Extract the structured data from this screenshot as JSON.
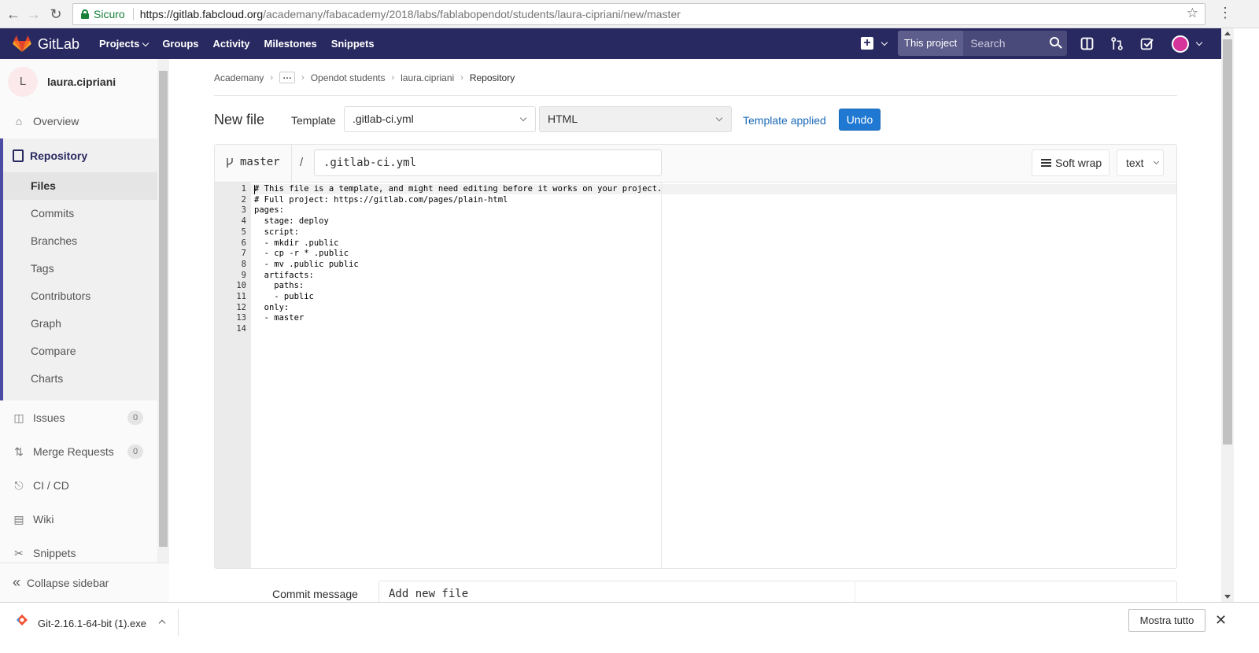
{
  "browser": {
    "secure_label": "Sicuro",
    "url_host": "https://gitlab.fabcloud.org",
    "url_path": "/academany/fabacademy/2018/labs/fablabopendot/students/laura-cipriani/new/master"
  },
  "header": {
    "brand": "GitLab",
    "nav": [
      "Projects",
      "Groups",
      "Activity",
      "Milestones",
      "Snippets"
    ],
    "search_scope": "This project",
    "search_placeholder": "Search"
  },
  "sidebar": {
    "avatar_letter": "L",
    "username": "laura.cipriani",
    "overview": "Overview",
    "repository": "Repository",
    "repo_items": [
      "Files",
      "Commits",
      "Branches",
      "Tags",
      "Contributors",
      "Graph",
      "Compare",
      "Charts"
    ],
    "issues": "Issues",
    "issues_count": "0",
    "merge_requests": "Merge Requests",
    "mr_count": "0",
    "cicd": "CI / CD",
    "wiki": "Wiki",
    "snippets": "Snippets",
    "collapse": "Collapse sidebar"
  },
  "breadcrumb": {
    "items": [
      "Academany",
      "Opendot students",
      "laura.cipriani"
    ],
    "current": "Repository"
  },
  "editor": {
    "title": "New file",
    "template_label": "Template",
    "template_value": ".gitlab-ci.yml",
    "type_value": "HTML",
    "template_applied": "Template applied",
    "undo": "Undo",
    "branch": "master",
    "slash": "/",
    "file_name": ".gitlab-ci.yml",
    "soft_wrap": "Soft wrap",
    "mode": "text",
    "lines": [
      "# This file is a template, and might need editing before it works on your project.",
      "# Full project: https://gitlab.com/pages/plain-html",
      "pages:",
      "  stage: deploy",
      "  script:",
      "  - mkdir .public",
      "  - cp -r * .public",
      "  - mv .public public",
      "  artifacts:",
      "    paths:",
      "    - public",
      "  only:",
      "  - master",
      ""
    ],
    "line_numbers": [
      "1",
      "2",
      "3",
      "4",
      "5",
      "6",
      "7",
      "8",
      "9",
      "10",
      "11",
      "12",
      "13",
      "14"
    ]
  },
  "commit": {
    "label": "Commit message",
    "value": "Add new file"
  },
  "download": {
    "file_name": "Git-2.16.1-64-bit (1).exe",
    "show_all": "Mostra tutto"
  },
  "colors": {
    "header_bg": "#292961",
    "accent": "#1f78d1",
    "link": "#1b69b6"
  }
}
